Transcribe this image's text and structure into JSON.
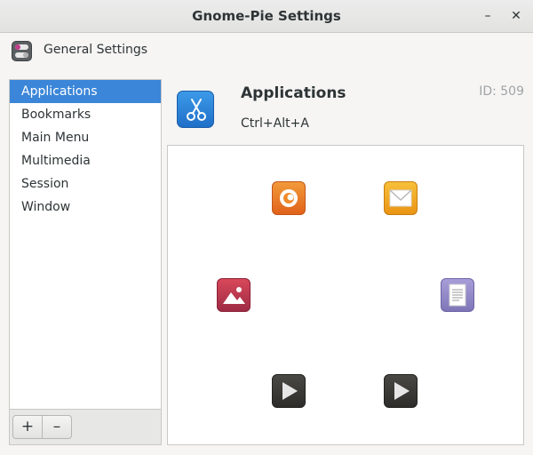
{
  "window": {
    "title": "Gnome-Pie Settings",
    "minimize_glyph": "–",
    "close_glyph": "✕"
  },
  "general": {
    "label": "General Settings",
    "icon": "toggle-switches-icon"
  },
  "sidebar": {
    "items": [
      {
        "label": "Applications",
        "selected": true
      },
      {
        "label": "Bookmarks",
        "selected": false
      },
      {
        "label": "Main Menu",
        "selected": false
      },
      {
        "label": "Multimedia",
        "selected": false
      },
      {
        "label": "Session",
        "selected": false
      },
      {
        "label": "Window",
        "selected": false
      }
    ],
    "add_label": "+",
    "remove_label": "–"
  },
  "pie": {
    "name": "Applications",
    "shortcut": "Ctrl+Alt+A",
    "id_text": "ID: 509",
    "icon": "scissors-icon"
  },
  "preview": {
    "slices": [
      {
        "name": "firefox-icon",
        "color": "#e8731e"
      },
      {
        "name": "mail-icon",
        "color": "#f1a51e"
      },
      {
        "name": "image-viewer-icon",
        "color": "#c13a4a"
      },
      {
        "name": "text-editor-icon",
        "color": "#8f86c6"
      },
      {
        "name": "media-player-icon",
        "color": "#3a3834"
      },
      {
        "name": "video-player-icon",
        "color": "#3a3834"
      }
    ]
  },
  "colors": {
    "selection": "#3b86d8",
    "window_bg": "#f6f5f4"
  }
}
